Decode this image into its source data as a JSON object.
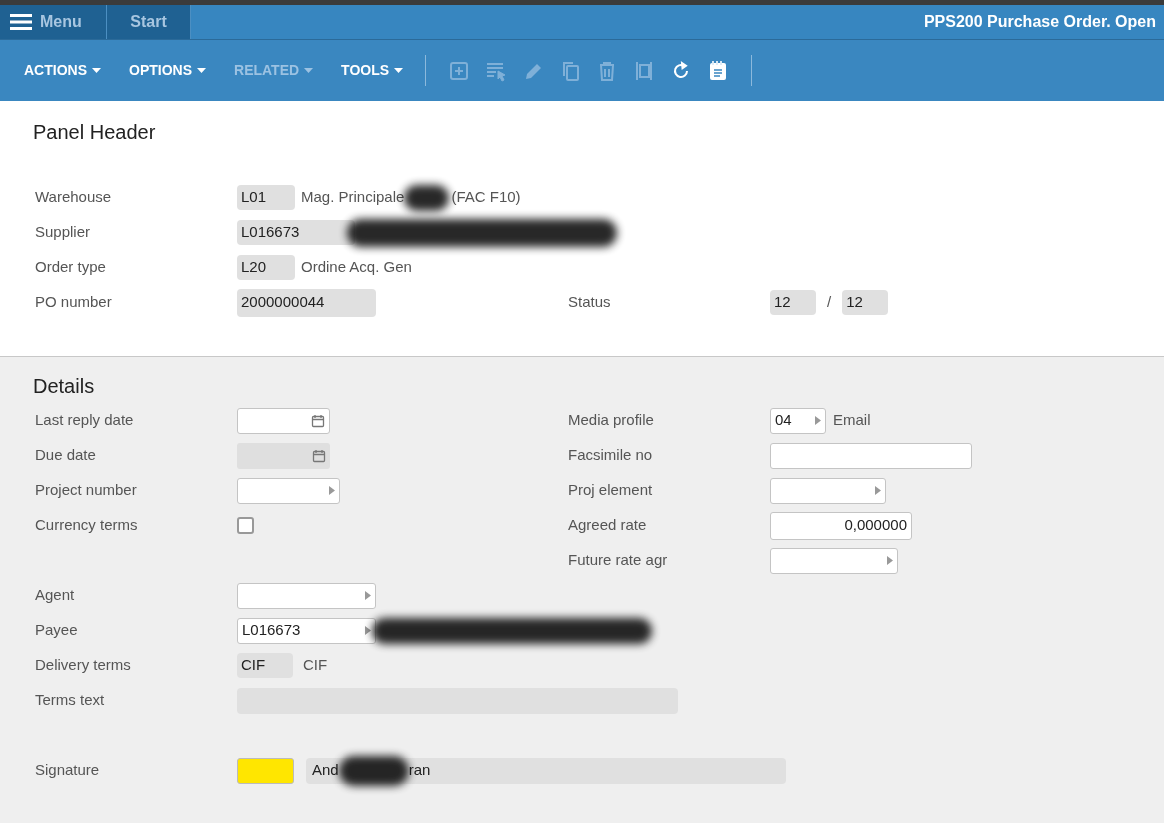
{
  "top_bar": {
    "menu_label": "Menu",
    "tabs": [
      {
        "label": "Start",
        "selected": true
      }
    ],
    "title": "PPS200 Purchase Order. Open"
  },
  "toolbar": {
    "menus": [
      {
        "label": "ACTIONS",
        "disabled": false
      },
      {
        "label": "OPTIONS",
        "disabled": false
      },
      {
        "label": "RELATED",
        "disabled": true
      },
      {
        "label": "TOOLS",
        "disabled": false
      }
    ],
    "icons": [
      {
        "disabled": true
      },
      {
        "disabled": true
      },
      {
        "disabled": true
      },
      {
        "disabled": true
      },
      {
        "disabled": true
      },
      {
        "disabled": true
      },
      {
        "disabled": false
      },
      {
        "disabled": false
      }
    ]
  },
  "panel_header": {
    "title": "Panel Header",
    "warehouse": {
      "label": "Warehouse",
      "code": "L01",
      "description_before": "Mag. Principale",
      "description_after": "(FAC F10)"
    },
    "supplier": {
      "label": "Supplier",
      "code": "L016673"
    },
    "order_type": {
      "label": "Order type",
      "code": "L20",
      "description": "Ordine Acq. Gen"
    },
    "po_number": {
      "label": "PO number",
      "value": "2000000044"
    },
    "status": {
      "label": "Status",
      "low": "12",
      "separator": "/",
      "high": "12"
    }
  },
  "details": {
    "title": "Details",
    "last_reply_date": {
      "label": "Last reply date",
      "disabled": false
    },
    "due_date": {
      "label": "Due date",
      "disabled": true
    },
    "project_number": {
      "label": "Project number"
    },
    "currency_terms": {
      "label": "Currency terms",
      "checked": false
    },
    "media_profile": {
      "label": "Media profile",
      "code": "04",
      "description": "Email"
    },
    "facsimile_no": {
      "label": "Facsimile no"
    },
    "proj_element": {
      "label": "Proj element"
    },
    "agreed_rate": {
      "label": "Agreed rate",
      "value": "0,000000"
    },
    "future_rate_agr": {
      "label": "Future rate agr"
    },
    "agent": {
      "label": "Agent"
    },
    "payee": {
      "label": "Payee",
      "value": "L016673"
    },
    "delivery_terms": {
      "label": "Delivery terms",
      "code": "CIF",
      "description": "CIF"
    },
    "terms_text": {
      "label": "Terms text"
    },
    "signature": {
      "label": "Signature",
      "name_start": "And",
      "name_end": "ran"
    }
  }
}
